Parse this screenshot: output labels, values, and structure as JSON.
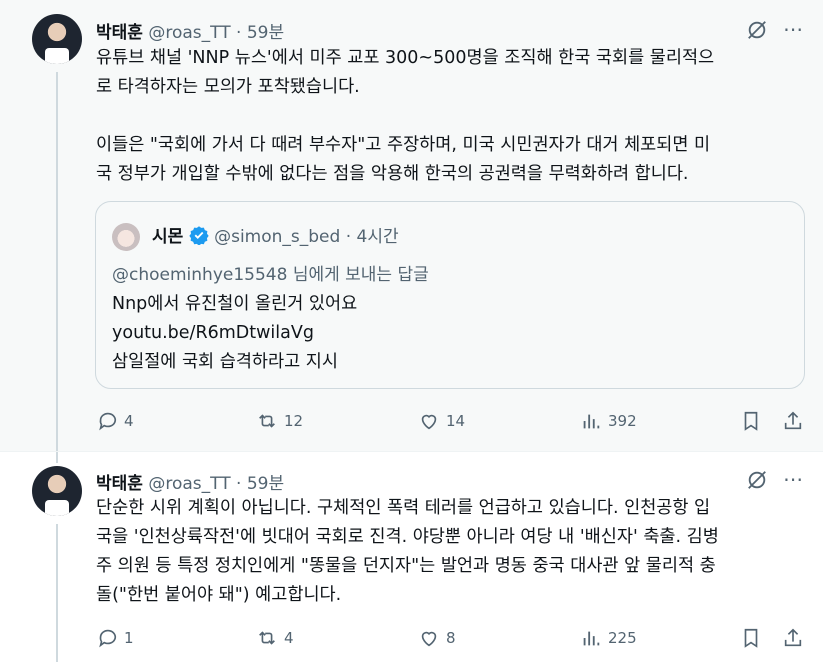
{
  "posts": [
    {
      "author_name": "박태훈",
      "handle": "@roas_TT",
      "separator": "·",
      "time": "59분",
      "text": "유튜브 채널 'NNP 뉴스'에서 미주 교포 300~500명을 조직해 한국 국회를 물리적으\n로 타격하자는 모의가 포착됐습니다.\n\n이들은 \"국회에 가서 다 때려 부수자\"고 주장하며, 미국 시민권자가 대거 체포되면 미\n국 정부가 개입할 수밖에 없다는 점을 악용해 한국의 공권력을 무력화하려 합니다.",
      "quote": {
        "author_name": "시몬",
        "verified": true,
        "handle": "@simon_s_bed",
        "separator": "·",
        "time": "4시간",
        "reply_to": "@choeminhye15548 님에게 보내는 답글",
        "lines": [
          "Nnp에서 유진철이 올린거 있어요",
          "youtu.be/R6mDtwilaVg",
          "삼일절에 국회 습격하라고 지시"
        ]
      },
      "actions": {
        "replies": "4",
        "reposts": "12",
        "likes": "14",
        "views": "392"
      }
    },
    {
      "author_name": "박태훈",
      "handle": "@roas_TT",
      "separator": "·",
      "time": "59분",
      "text": "단순한 시위 계획이 아닙니다. 구체적인 폭력 테러를 언급하고 있습니다. 인천공항 입\n국을 '인천상륙작전'에 빗대어 국회로 진격. 야당뿐 아니라 여당 내 '배신자' 축출. 김병\n주 의원 등 특정 정치인에게 \"똥물을 던지자\"는 발언과 명동 중국 대사관 앞 물리적 충\n돌(\"한번 붙어야 돼\") 예고합니다.",
      "actions": {
        "replies": "1",
        "reposts": "4",
        "likes": "8",
        "views": "225"
      }
    }
  ],
  "icons": {
    "grok": "grok-icon",
    "more": "more-icon",
    "reply": "reply-icon",
    "repost": "repost-icon",
    "like": "like-icon",
    "views": "views-icon",
    "bookmark": "bookmark-icon",
    "share": "share-icon",
    "verified": "verified-badge-icon"
  },
  "colors": {
    "text": "#0f1419",
    "secondary": "#536471",
    "verified": "#1d9bf0",
    "border": "#cfd9de"
  }
}
